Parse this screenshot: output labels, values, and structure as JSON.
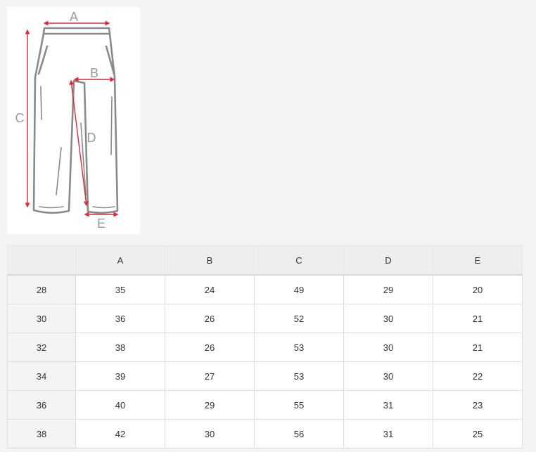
{
  "diagram": {
    "letters": [
      "A",
      "B",
      "C",
      "D",
      "E"
    ],
    "colors": {
      "outline": "#8a8a8a",
      "arrow": "#e0253c",
      "letter": "#9a9a9a"
    }
  },
  "table": {
    "headers": [
      "",
      "A",
      "B",
      "C",
      "D",
      "E"
    ],
    "rows": [
      [
        "28",
        "35",
        "24",
        "49",
        "29",
        "20"
      ],
      [
        "30",
        "36",
        "26",
        "52",
        "30",
        "21"
      ],
      [
        "32",
        "38",
        "26",
        "53",
        "30",
        "21"
      ],
      [
        "34",
        "39",
        "27",
        "53",
        "30",
        "22"
      ],
      [
        "36",
        "40",
        "29",
        "55",
        "31",
        "23"
      ],
      [
        "38",
        "42",
        "30",
        "56",
        "31",
        "25"
      ]
    ]
  }
}
